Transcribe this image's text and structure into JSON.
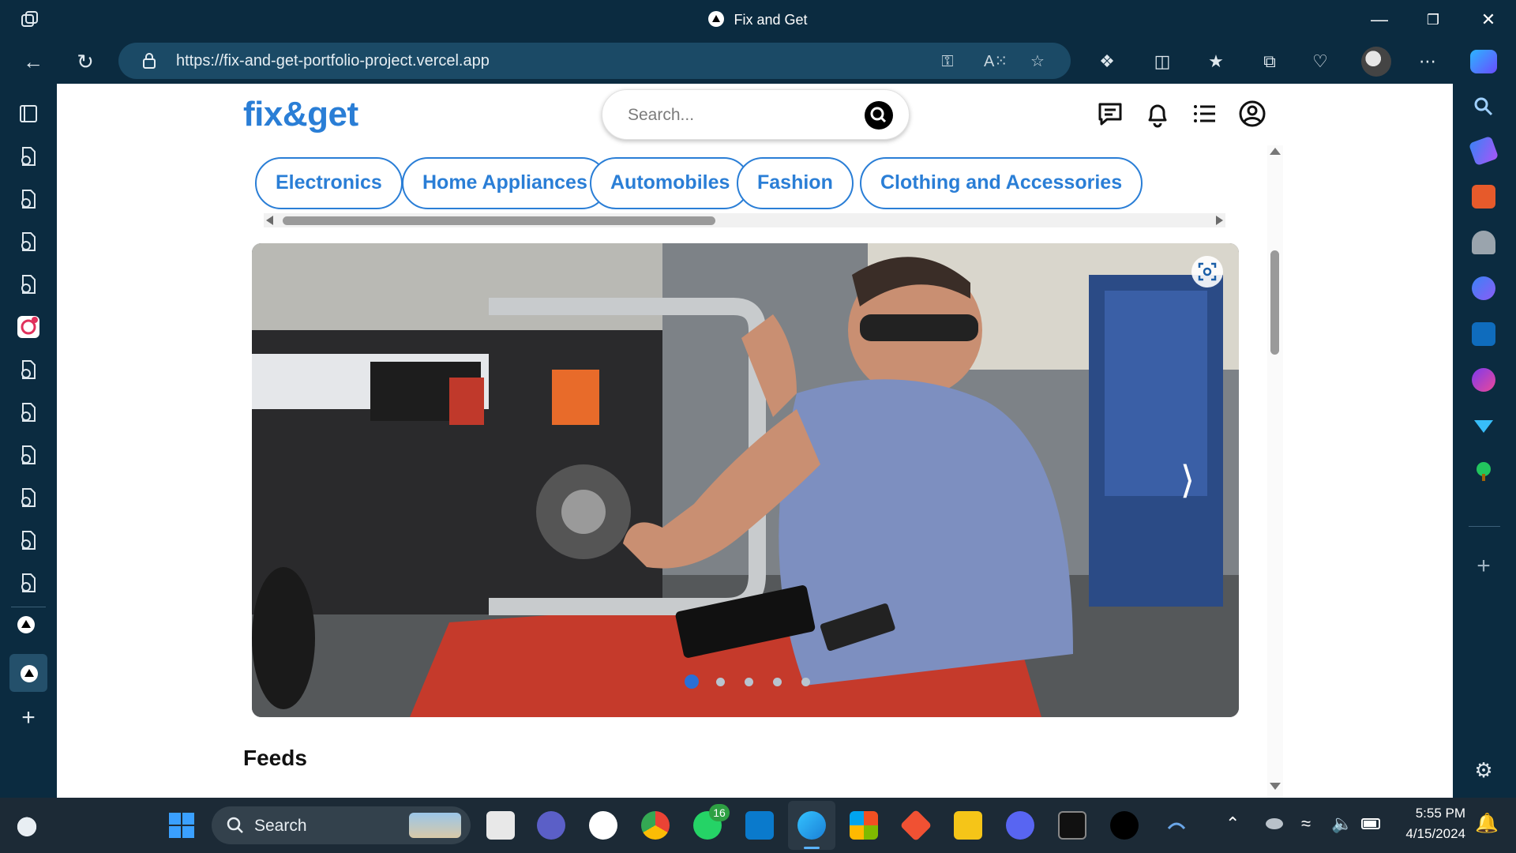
{
  "browser": {
    "tab_title": "Fix and Get",
    "url": "https://fix-and-get-portfolio-project.vercel.app"
  },
  "site": {
    "brand": "fix&get",
    "search": {
      "placeholder": "Search..."
    },
    "categories": [
      {
        "label": "Electronics"
      },
      {
        "label": "Home Appliances"
      },
      {
        "label": "Automobiles"
      },
      {
        "label": "Fashion"
      },
      {
        "label": "Clothing and Accessories"
      }
    ],
    "carousel": {
      "active_slide": 1,
      "slide_count": 5
    },
    "feeds_title": "Feeds"
  },
  "taskbar": {
    "search_label": "Search",
    "whatsapp_badge": "16",
    "time": "5:55 PM",
    "date": "4/15/2024"
  },
  "colors": {
    "brand_blue": "#2a7ed6",
    "chrome_dark": "#0b2b40",
    "taskbar": "#1c2a36"
  },
  "icons": {
    "header": [
      "chat-icon",
      "bell-icon",
      "list-icon",
      "account-icon"
    ],
    "browser_tools": [
      "extensions-icon",
      "split-screen-icon",
      "favorites-icon",
      "collections-icon",
      "browser-essentials-icon",
      "more-icon",
      "copilot-icon"
    ]
  }
}
